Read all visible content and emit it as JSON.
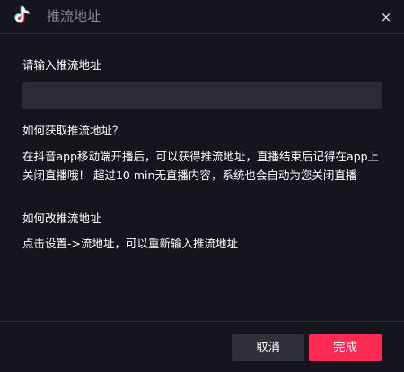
{
  "header": {
    "title": "推流地址",
    "close_glyph": "×",
    "logo_icon": "tiktok-logo-icon",
    "close_icon": "close-icon"
  },
  "form": {
    "label": "请输入推流地址",
    "input_value": "",
    "input_placeholder": ""
  },
  "help": {
    "q1": "如何获取推流地址？",
    "a1": "在抖音app移动端开播后，可以获得推流地址，直播结束后记得在app上关闭直播哦！ 超过10 min无直播内容，系统也会自动为您关闭直播",
    "q2": "如何改推流地址",
    "a2": "点击设置->流地址，可以重新输入推流地址"
  },
  "footer": {
    "cancel_label": "取消",
    "done_label": "完成"
  },
  "colors": {
    "background": "#15161d",
    "input_bg": "#2b2c33",
    "cancel_bg": "#2e2f37",
    "accent": "#fe2c55",
    "title_text": "#8a8b91"
  }
}
